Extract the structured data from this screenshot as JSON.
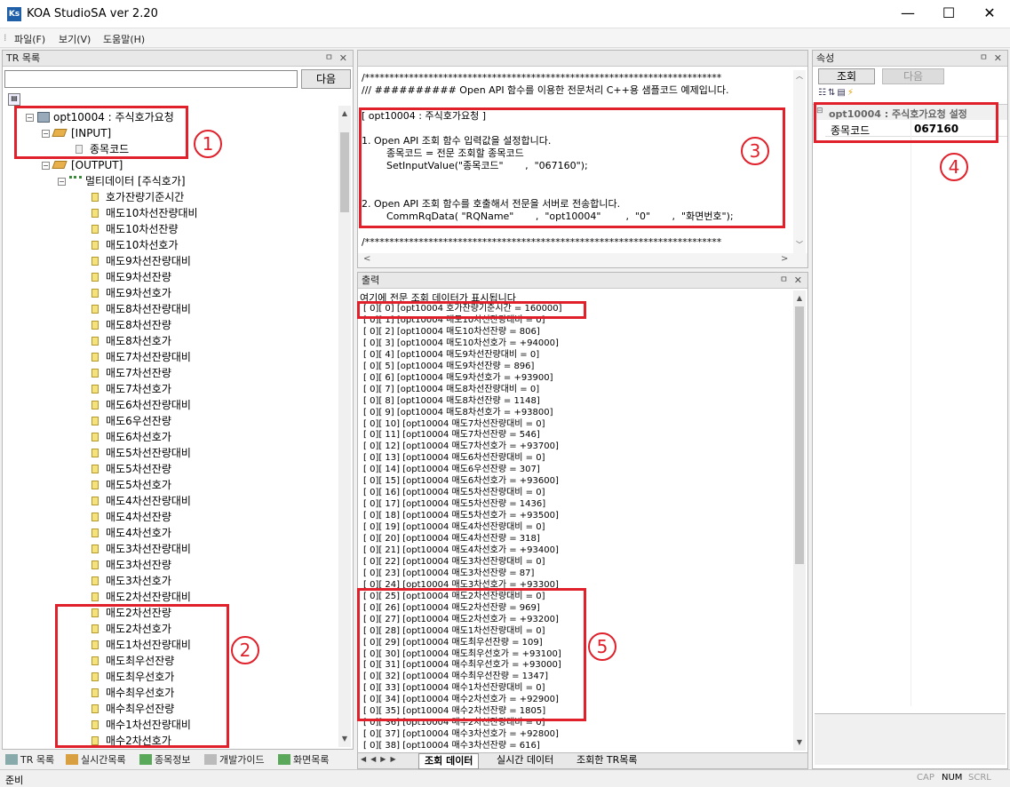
{
  "window": {
    "icon_text": "Ks",
    "title": "KOA StudioSA ver 2.20",
    "controls": {
      "minimize": "—",
      "maximize": "☐",
      "close": "✕"
    }
  },
  "menu": [
    "파일(F)",
    "보기(V)",
    "도움말(H)"
  ],
  "tr_panel": {
    "title": "TR 목록",
    "search_value": "",
    "next_button": "다음",
    "tree": {
      "root": "opt10004 : 주식호가요청",
      "input_folder": "[INPUT]",
      "input_items": [
        "종목코드"
      ],
      "output_folder": "[OUTPUT]",
      "multi_folder": "멀티데이터 [주식호가]",
      "multi_items": [
        "호가잔량기준시간",
        "매도10차선잔량대비",
        "매도10차선잔량",
        "매도10차선호가",
        "매도9차선잔량대비",
        "매도9차선잔량",
        "매도9차선호가",
        "매도8차선잔량대비",
        "매도8차선잔량",
        "매도8차선호가",
        "매도7차선잔량대비",
        "매도7차선잔량",
        "매도7차선호가",
        "매도6차선잔량대비",
        "매도6우선잔량",
        "매도6차선호가",
        "매도5차선잔량대비",
        "매도5차선잔량",
        "매도5차선호가",
        "매도4차선잔량대비",
        "매도4차선잔량",
        "매도4차선호가",
        "매도3차선잔량대비",
        "매도3차선잔량",
        "매도3차선호가",
        "매도2차선잔량대비",
        "매도2차선잔량",
        "매도2차선호가",
        "매도1차선잔량대비",
        "매도최우선잔량",
        "매도최우선호가",
        "매수최우선호가",
        "매수최우선잔량",
        "매수1차선잔량대비",
        "매수2차선호가"
      ]
    }
  },
  "code_panel": {
    "lines": [
      "/*************************************************************************",
      "/// ########## Open API 함수를 이용한 전문처리 C++용 샘플코드 예제입니다.",
      "",
      "[ opt10004 : 주식호가요청 ]",
      "",
      "1. Open API 조회 함수 입력값을 설정합니다.",
      "        종목코드 = 전문 조회할 종목코드",
      "        SetInputValue(\"종목코드\"       ,  \"067160\");",
      "",
      "",
      "2. Open API 조회 함수를 호출해서 전문을 서버로 전송합니다.",
      "        CommRqData( \"RQName\"       ,  \"opt10004\"        ,  \"0\"       ,  \"화면번호\");",
      "",
      "/*************************************************************************"
    ]
  },
  "output_panel": {
    "title": "출력",
    "header_text": "여기에 전문 조회 데이터가 표시됩니다",
    "lines": [
      "[  0][  0] [opt10004 호가잔량기준시간 = 160000]",
      "[  0][  1] [opt10004 매도10차선잔량대비 = 0]",
      "[  0][  2] [opt10004 매도10차선잔량 = 806]",
      "[  0][  3] [opt10004 매도10차선호가 = +94000]",
      "[  0][  4] [opt10004 매도9차선잔량대비 = 0]",
      "[  0][  5] [opt10004 매도9차선잔량 = 896]",
      "[  0][  6] [opt10004 매도9차선호가 = +93900]",
      "[  0][  7] [opt10004 매도8차선잔량대비 = 0]",
      "[  0][  8] [opt10004 매도8차선잔량 = 1148]",
      "[  0][  9] [opt10004 매도8차선호가 = +93800]",
      "[  0][ 10] [opt10004 매도7차선잔량대비 = 0]",
      "[  0][ 11] [opt10004 매도7차선잔량 = 546]",
      "[  0][ 12] [opt10004 매도7차선호가 = +93700]",
      "[  0][ 13] [opt10004 매도6차선잔량대비 = 0]",
      "[  0][ 14] [opt10004 매도6우선잔량 = 307]",
      "[  0][ 15] [opt10004 매도6차선호가 = +93600]",
      "[  0][ 16] [opt10004 매도5차선잔량대비 = 0]",
      "[  0][ 17] [opt10004 매도5차선잔량 = 1436]",
      "[  0][ 18] [opt10004 매도5차선호가 = +93500]",
      "[  0][ 19] [opt10004 매도4차선잔량대비 = 0]",
      "[  0][ 20] [opt10004 매도4차선잔량 = 318]",
      "[  0][ 21] [opt10004 매도4차선호가 = +93400]",
      "[  0][ 22] [opt10004 매도3차선잔량대비 = 0]",
      "[  0][ 23] [opt10004 매도3차선잔량 = 87]",
      "[  0][ 24] [opt10004 매도3차선호가 = +93300]",
      "[  0][ 25] [opt10004 매도2차선잔량대비 = 0]",
      "[  0][ 26] [opt10004 매도2차선잔량 = 969]",
      "[  0][ 27] [opt10004 매도2차선호가 = +93200]",
      "[  0][ 28] [opt10004 매도1차선잔량대비 = 0]",
      "[  0][ 29] [opt10004 매도최우선잔량 = 109]",
      "[  0][ 30] [opt10004 매도최우선호가 = +93100]",
      "[  0][ 31] [opt10004 매수최우선호가 = +93000]",
      "[  0][ 32] [opt10004 매수최우선잔량 = 1347]",
      "[  0][ 33] [opt10004 매수1차선잔량대비 = 0]",
      "[  0][ 34] [opt10004 매수2차선호가 = +92900]",
      "[  0][ 35] [opt10004 매수2차선잔량 = 1805]",
      "[  0][ 36] [opt10004 매수2차선잔량대비 = 0]",
      "[  0][ 37] [opt10004 매수3차선호가 = +92800]",
      "[  0][ 38] [opt10004 매수3차선잔량 = 616]"
    ],
    "tabs": [
      "조회 데이터",
      "실시간 데이터",
      "조회한 TR목록"
    ]
  },
  "props_panel": {
    "title": "속성",
    "query_button": "조회",
    "next_button": "다음",
    "category": "opt10004 : 주식호가요청 설정",
    "rows": [
      {
        "name": "종목코드",
        "value": "067160"
      }
    ]
  },
  "bottom_tabs": [
    "TR 목록",
    "실시간목록",
    "종목정보",
    "개발가이드",
    "화면목록"
  ],
  "status": {
    "left": "준비",
    "indicators": [
      "CAP",
      "NUM",
      "SCRL"
    ]
  },
  "annotations": [
    "1",
    "2",
    "3",
    "4",
    "5"
  ],
  "colors": {
    "annotation_red": "#e0202a",
    "app_icon": "#1f5fa8"
  }
}
